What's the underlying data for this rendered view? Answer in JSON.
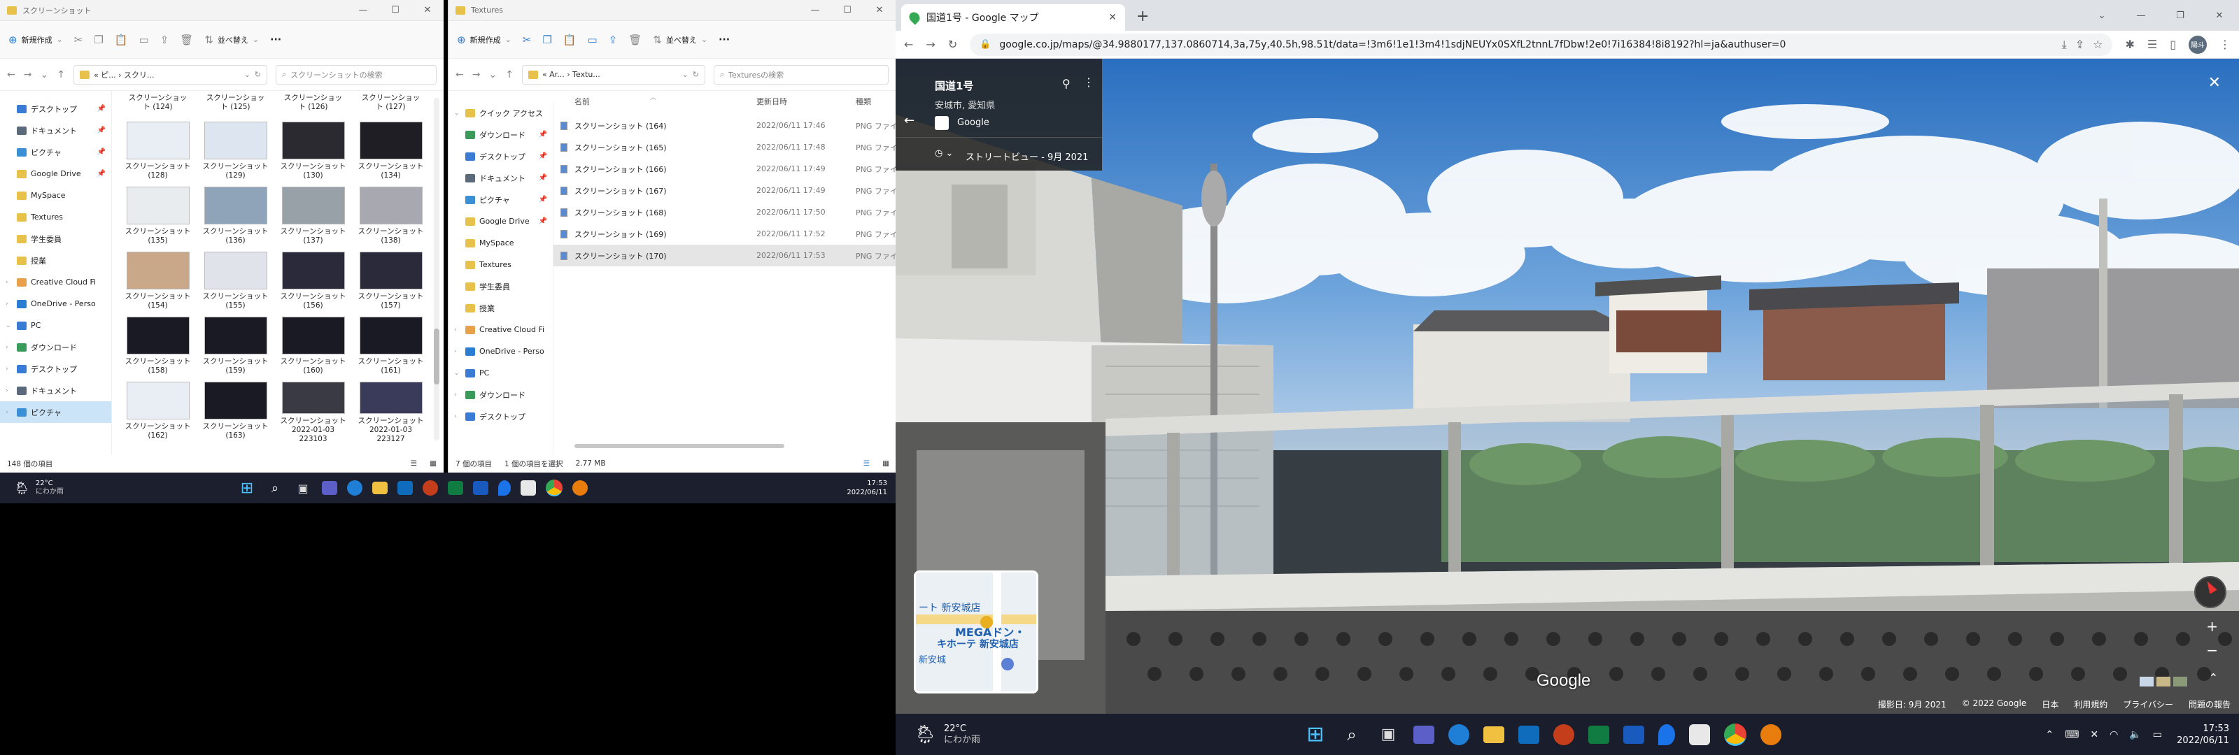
{
  "explorer1": {
    "title": "スクリーンショット",
    "cmd_new": "新規作成",
    "cmd_sort": "並べ替え",
    "cmd_more": "···",
    "path": "« ピ... › スクリ...",
    "search_placeholder": "スクリーンショットの検索",
    "nav": [
      {
        "label": "デスクトップ",
        "color": "#3a7bd5",
        "pin": true
      },
      {
        "label": "ドキュメント",
        "color": "#5a6a7a",
        "pin": true
      },
      {
        "label": "ピクチャ",
        "color": "#3a8fd5",
        "pin": true
      },
      {
        "label": "Google Drive",
        "color": "#e8c14a",
        "pin": true
      },
      {
        "label": "MySpace",
        "color": "#e8c14a",
        "pin": false
      },
      {
        "label": "Textures",
        "color": "#e8c14a",
        "pin": false
      },
      {
        "label": "学生委員",
        "color": "#e8c14a",
        "pin": false
      },
      {
        "label": "授業",
        "color": "#e8c14a",
        "pin": false
      },
      {
        "label": "Creative Cloud Fi",
        "color": "#e8a14a",
        "pin": false
      },
      {
        "label": "OneDrive - Perso",
        "color": "#2b7cd3",
        "pin": false
      },
      {
        "label": "PC",
        "color": "#3a7bd5",
        "pin": false
      },
      {
        "label": "ダウンロード",
        "color": "#3a9a5a",
        "pin": false
      },
      {
        "label": "デスクトップ",
        "color": "#3a7bd5",
        "pin": false
      },
      {
        "label": "ドキュメント",
        "color": "#5a6a7a",
        "pin": false
      },
      {
        "label": "ピクチャ",
        "color": "#3a8fd5",
        "pin": false
      }
    ],
    "top_row": [
      "スクリーンショット (124)",
      "スクリーンショット (125)",
      "スクリーンショット (126)",
      "スクリーンショット (127)"
    ],
    "items": [
      {
        "l1": "スクリーンショット",
        "l2": "(128)",
        "c": "#e8eef4"
      },
      {
        "l1": "スクリーンショット",
        "l2": "(129)",
        "c": "#dde6f0"
      },
      {
        "l1": "スクリーンショット",
        "l2": "(130)",
        "c": "#2a2a30"
      },
      {
        "l1": "スクリーンショット",
        "l2": "(134)",
        "c": "#1e1e24"
      },
      {
        "l1": "スクリーンショット",
        "l2": "(135)",
        "c": "#e9ecef"
      },
      {
        "l1": "スクリーンショット",
        "l2": "(136)",
        "c": "#8fa4b8"
      },
      {
        "l1": "スクリーンショット",
        "l2": "(137)",
        "c": "#98a0a8"
      },
      {
        "l1": "スクリーンショット",
        "l2": "(138)",
        "c": "#a8a8b0"
      },
      {
        "l1": "スクリーンショット",
        "l2": "(154)",
        "c": "#c9a88a"
      },
      {
        "l1": "スクリーンショット",
        "l2": "(155)",
        "c": "#e0e4ea"
      },
      {
        "l1": "スクリーンショット",
        "l2": "(156)",
        "c": "#2a2a3a"
      },
      {
        "l1": "スクリーンショット",
        "l2": "(157)",
        "c": "#2a2a3a"
      },
      {
        "l1": "スクリーンショット",
        "l2": "(158)",
        "c": "#1a1a24"
      },
      {
        "l1": "スクリーンショット",
        "l2": "(159)",
        "c": "#1a1a24"
      },
      {
        "l1": "スクリーンショット",
        "l2": "(160)",
        "c": "#1a1a24"
      },
      {
        "l1": "スクリーンショット",
        "l2": "(161)",
        "c": "#1a1a24"
      },
      {
        "l1": "スクリーンショット",
        "l2": "(162)",
        "c": "#e8eef4"
      },
      {
        "l1": "スクリーンショット",
        "l2": "(163)",
        "c": "#1a1a24"
      },
      {
        "l1": "スクリーンショット",
        "l2": "2022-01-03 223103",
        "c": "#3a3a44"
      },
      {
        "l1": "スクリーンショット",
        "l2": "2022-01-03 223127",
        "c": "#3a3a5a"
      }
    ],
    "status_count": "148 個の項目"
  },
  "explorer2": {
    "title": "Textures",
    "cmd_new": "新規作成",
    "cmd_sort": "並べ替え",
    "cmd_more": "···",
    "path": "« Ar... › Textu...",
    "search_placeholder": "Texturesの検索",
    "nav": [
      {
        "label": "クイック アクセス",
        "color": "#e8c14a",
        "pin": false,
        "star": true
      },
      {
        "label": "ダウンロード",
        "color": "#3a9a5a",
        "pin": true
      },
      {
        "label": "デスクトップ",
        "color": "#3a7bd5",
        "pin": true
      },
      {
        "label": "ドキュメント",
        "color": "#5a6a7a",
        "pin": true
      },
      {
        "label": "ピクチャ",
        "color": "#3a8fd5",
        "pin": true
      },
      {
        "label": "Google Drive",
        "color": "#e8c14a",
        "pin": true
      },
      {
        "label": "MySpace",
        "color": "#e8c14a",
        "pin": false
      },
      {
        "label": "Textures",
        "color": "#e8c14a",
        "pin": false
      },
      {
        "label": "学生委員",
        "color": "#e8c14a",
        "pin": false
      },
      {
        "label": "授業",
        "color": "#e8c14a",
        "pin": false
      },
      {
        "label": "Creative Cloud Fi",
        "color": "#e8a14a",
        "pin": false
      },
      {
        "label": "OneDrive - Perso",
        "color": "#2b7cd3",
        "pin": false
      },
      {
        "label": "PC",
        "color": "#3a7bd5",
        "pin": false
      },
      {
        "label": "ダウンロード",
        "color": "#3a9a5a",
        "pin": false
      },
      {
        "label": "デスクトップ",
        "color": "#3a7bd5",
        "pin": false
      }
    ],
    "col_name": "名前",
    "col_date": "更新日時",
    "col_type": "種類",
    "rows": [
      {
        "name": "スクリーンショット (164)",
        "date": "2022/06/11 17:46",
        "type": "PNG ファイ"
      },
      {
        "name": "スクリーンショット (165)",
        "date": "2022/06/11 17:48",
        "type": "PNG ファイ"
      },
      {
        "name": "スクリーンショット (166)",
        "date": "2022/06/11 17:49",
        "type": "PNG ファイ"
      },
      {
        "name": "スクリーンショット (167)",
        "date": "2022/06/11 17:49",
        "type": "PNG ファイ"
      },
      {
        "name": "スクリーンショット (168)",
        "date": "2022/06/11 17:50",
        "type": "PNG ファイ"
      },
      {
        "name": "スクリーンショット (169)",
        "date": "2022/06/11 17:52",
        "type": "PNG ファイ"
      },
      {
        "name": "スクリーンショット (170)",
        "date": "2022/06/11 17:53",
        "type": "PNG ファイ"
      }
    ],
    "status_count": "7 個の項目",
    "status_sel": "1 個の項目を選択",
    "status_size": "2.77 MB"
  },
  "taskbar_small": {
    "temp": "22°C",
    "weather": "にわか雨",
    "time": "17:53",
    "date": "2022/06/11"
  },
  "chrome": {
    "tab_title": "国道1号 - Google マップ",
    "new_tab": "+",
    "url": "google.co.jp/maps/@34.9880177,137.0860714,3a,75y,40.5h,98.51t/data=!3m6!1e1!3m4!1sdjNEUYx0SXfL2tnnL7fDbw!2e0!7i16384!8i8192?hl=ja&authuser=0",
    "profile": "陽斗"
  },
  "maps": {
    "place": "国道1号",
    "locality": "安城市, 愛知県",
    "source": "Google",
    "sv_label": "ストリートビュー - 9月 2021",
    "minimap_line1": "ート 新安城店",
    "minimap_line2": "MEGAドン・",
    "minimap_line3": "キホーテ 新安城店",
    "minimap_line4": "新安城",
    "watermark": "Google",
    "footer": [
      "撮影日: 9月 2021",
      "© 2022 Google",
      "日本",
      "利用規約",
      "プライバシー",
      "問題の報告"
    ]
  },
  "taskbar_big": {
    "temp": "22°C",
    "weather": "にわか雨",
    "time": "17:53",
    "date": "2022/06/11"
  }
}
